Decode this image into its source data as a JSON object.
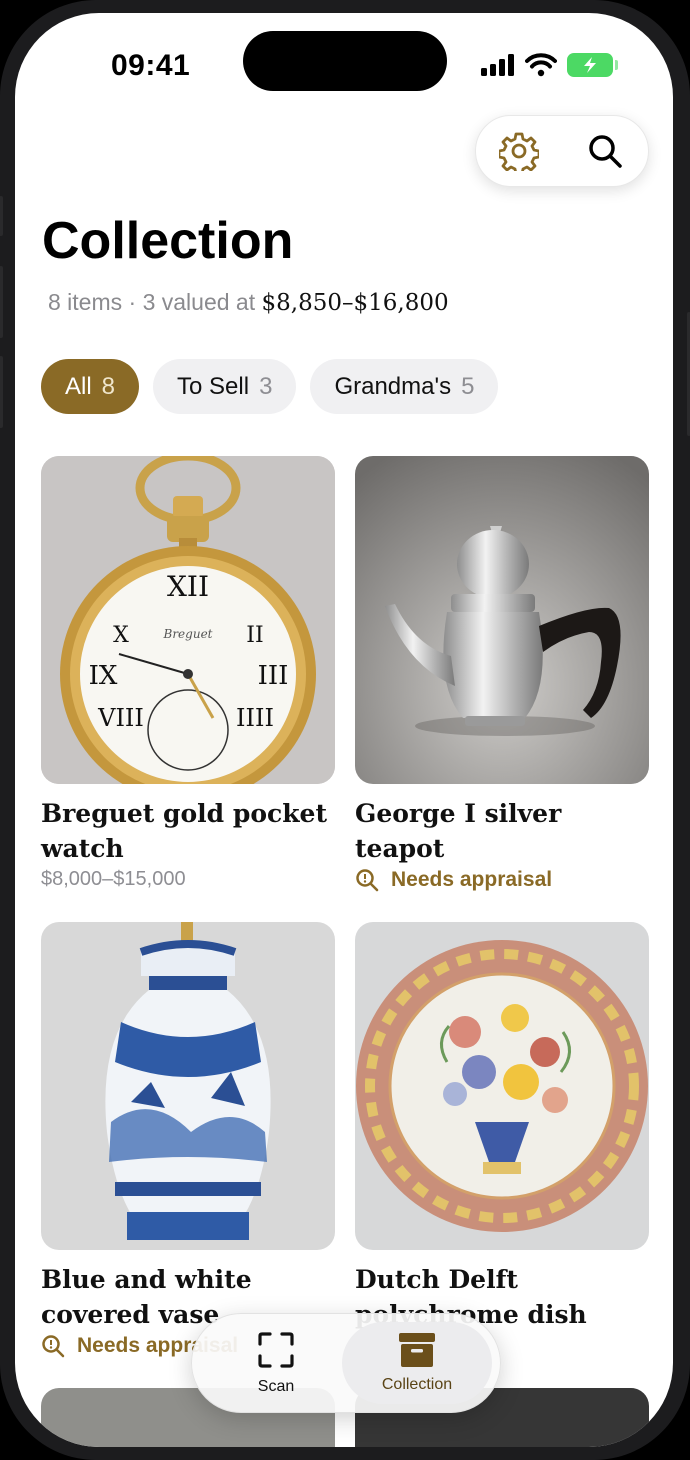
{
  "status_bar": {
    "time": "09:41"
  },
  "toolbar": {
    "settings_icon": "gear-icon",
    "search_icon": "search-icon"
  },
  "page": {
    "title": "Collection",
    "summary_prefix": "8 items · 3 valued at ",
    "summary_range": "$8,850–$16,800"
  },
  "filters": [
    {
      "label": "All",
      "count": "8"
    },
    {
      "label": "To Sell",
      "count": "3"
    },
    {
      "label": "Grandma's",
      "count": "5"
    }
  ],
  "items": [
    {
      "title": "Breguet gold pocket watch",
      "price": "$8,000–$15,000"
    },
    {
      "title": "George I silver teapot",
      "status": "Needs appraisal"
    },
    {
      "title": "Blue and white covered vase",
      "status": "Needs appraisal"
    },
    {
      "title": "Dutch Delft polychrome dish"
    }
  ],
  "dock": {
    "scan_label": "Scan",
    "collection_label": "Collection"
  },
  "colors": {
    "accent": "#8a6a26",
    "battery": "#4cd964"
  }
}
